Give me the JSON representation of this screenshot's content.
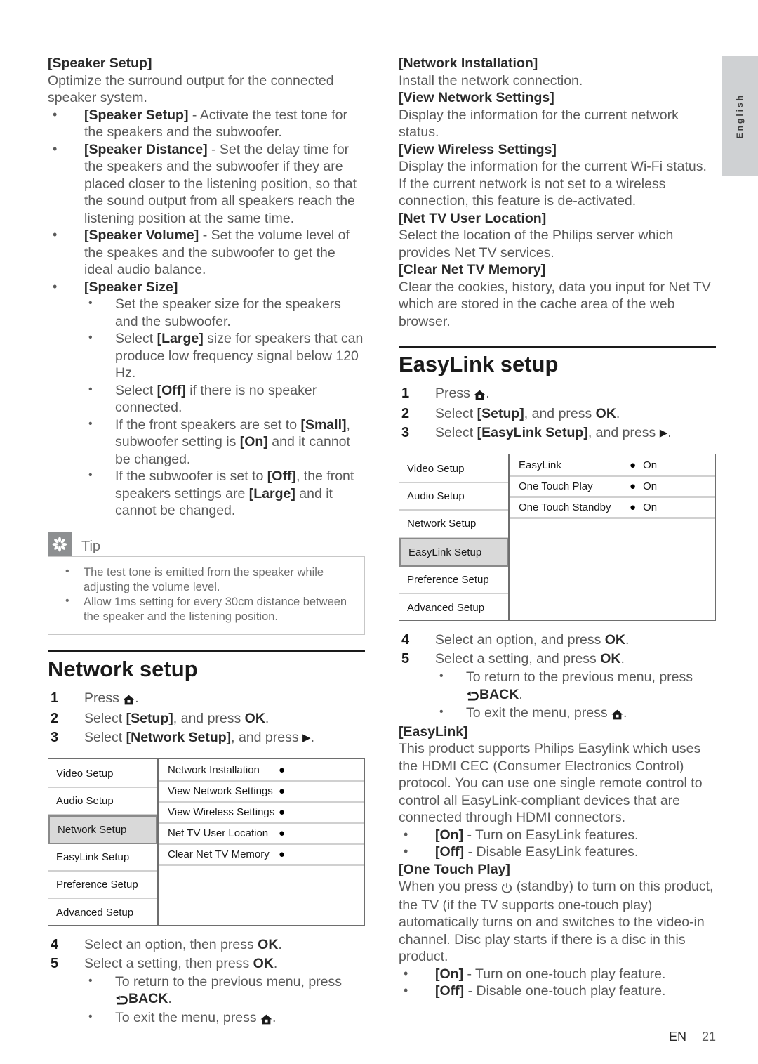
{
  "language_tab": {
    "label": "English"
  },
  "footer": {
    "locale": "EN",
    "page_number": "21"
  },
  "icons": {
    "home": "home-icon",
    "right_arrow": "right-arrow-icon",
    "back": "back-arrow-icon",
    "power": "standby-power-icon",
    "tip": "tip-asterisk-icon"
  },
  "left_column": {
    "speaker_setup": {
      "heading": "[Speaker Setup]",
      "intro": "Optimize the surround output for the connected speaker system.",
      "bullets": [
        {
          "term": "[Speaker Setup]",
          "rest": " - Activate the test tone for the speakers and the subwoofer."
        },
        {
          "term": "[Speaker Distance]",
          "rest": " - Set the delay time for the speakers and the subwoofer if they are placed closer to the listening position, so that the sound output from all speakers reach the listening position at the same time."
        },
        {
          "term": "[Speaker Volume]",
          "rest": " - Set the volume level of the speakes and the subwoofer to get the ideal audio balance."
        }
      ],
      "speaker_size": {
        "term": "[Speaker Size]",
        "sub_bullets": [
          "Set the speaker size for the speakers and the subwoofer.",
          "Select [Large] size for speakers that can produce low frequency signal below 120 Hz.",
          "Select [Off] if there is no speaker connected.",
          "If the front speakers are set to [Small], subwoofer setting is [On] and it cannot be changed.",
          "If the subwoofer is set to [Off], the front speakers settings are [Large] and it cannot be changed."
        ]
      }
    },
    "tip": {
      "label": "Tip",
      "items": [
        "The test tone is emitted from the speaker while adjusting the volume level.",
        "Allow 1ms setting for every 30cm distance between the speaker and the listening position."
      ]
    },
    "network_setup": {
      "title": "Network setup",
      "steps": [
        {
          "num": "1",
          "text_a": "Press ",
          "text_b": "."
        },
        {
          "num": "2",
          "text_a": "Select ",
          "term": "[Setup]",
          "text_b": ", and press ",
          "key": "OK",
          "text_c": "."
        },
        {
          "num": "3",
          "text_a": "Select ",
          "term": "[Network Setup]",
          "text_b": ", and press ",
          "text_c": "."
        }
      ],
      "menu": {
        "left_items": [
          "Video Setup",
          "Audio Setup",
          "Network Setup",
          "EasyLink Setup",
          "Preference Setup",
          "Advanced Setup"
        ],
        "selected_index": 2,
        "right_rows": [
          {
            "label": "Network Installation",
            "value": ""
          },
          {
            "label": "View Network Settings",
            "value": ""
          },
          {
            "label": "View Wireless Settings",
            "value": ""
          },
          {
            "label": "Net TV User Location",
            "value": ""
          },
          {
            "label": "Clear Net TV Memory",
            "value": ""
          }
        ]
      },
      "steps_after": [
        {
          "num": "4",
          "text_a": "Select an option, then press ",
          "key": "OK",
          "text_b": "."
        },
        {
          "num": "5",
          "text_a": "Select a setting, then press ",
          "key": "OK",
          "text_b": "."
        }
      ],
      "sub_bullets": [
        {
          "text_a": "To return to the previous menu, press ",
          "key": "BACK",
          "text_b": "."
        },
        {
          "text_a": "To exit the menu, press ",
          "text_b": "."
        }
      ]
    }
  },
  "right_column": {
    "network_options": [
      {
        "heading": "[Network Installation]",
        "body": "Install the network connection."
      },
      {
        "heading": "[View Network Settings]",
        "body": "Display the information for the current network status."
      },
      {
        "heading": "[View Wireless Settings]",
        "body": "Display the information for the current Wi-Fi status. If the current network is not set to a wireless connection, this feature is de-activated."
      },
      {
        "heading": "[Net TV User Location]",
        "body": "Select the location of the Philips server which provides Net TV services."
      },
      {
        "heading": "[Clear Net TV Memory]",
        "body": "Clear the cookies, history, data you input for Net TV which are stored in the cache area of the web browser."
      }
    ],
    "easylink_setup": {
      "title": "EasyLink setup",
      "steps": [
        {
          "num": "1",
          "text_a": "Press ",
          "text_b": "."
        },
        {
          "num": "2",
          "text_a": "Select ",
          "term": "[Setup]",
          "text_b": ", and press ",
          "key": "OK",
          "text_c": "."
        },
        {
          "num": "3",
          "text_a": "Select ",
          "term": "[EasyLink Setup]",
          "text_b": ", and press ",
          "text_c": "."
        }
      ],
      "menu": {
        "left_items": [
          "Video Setup",
          "Audio Setup",
          "Network Setup",
          "EasyLink Setup",
          "Preference Setup",
          "Advanced Setup"
        ],
        "selected_index": 3,
        "right_rows": [
          {
            "label": "EasyLink",
            "value": "On"
          },
          {
            "label": "One Touch Play",
            "value": "On"
          },
          {
            "label": "One Touch Standby",
            "value": "On"
          }
        ]
      },
      "steps_after": [
        {
          "num": "4",
          "text_a": "Select an option, and press ",
          "key": "OK",
          "text_b": "."
        },
        {
          "num": "5",
          "text_a": "Select a setting, and press ",
          "key": "OK",
          "text_b": "."
        }
      ],
      "sub_bullets": [
        {
          "text_a": "To return to the previous menu, press ",
          "key": "BACK",
          "text_b": "."
        },
        {
          "text_a": "To exit the menu, press ",
          "text_b": "."
        }
      ]
    },
    "easylink": {
      "heading": "[EasyLink]",
      "body": "This product supports Philips Easylink which uses the HDMI CEC (Consumer Electronics Control) protocol. You can use one single remote control to control all EasyLink-compliant devices that are connected through HDMI connectors.",
      "bullets": [
        {
          "term": "[On]",
          "rest": " - Turn on EasyLink features."
        },
        {
          "term": "[Off]",
          "rest": " - Disable EasyLink features."
        }
      ]
    },
    "one_touch_play": {
      "heading": "[One Touch Play]",
      "body_a": "When you press ",
      "body_b": " (standby) to turn on this product, the TV (if the TV supports one-touch play) automatically turns on and switches to the video-in channel. Disc play starts if there is a disc in this product.",
      "bullets": [
        {
          "term": "[On]",
          "rest": " - Turn on one-touch play feature."
        },
        {
          "term": "[Off]",
          "rest": " - Disable one-touch play feature."
        }
      ]
    }
  }
}
